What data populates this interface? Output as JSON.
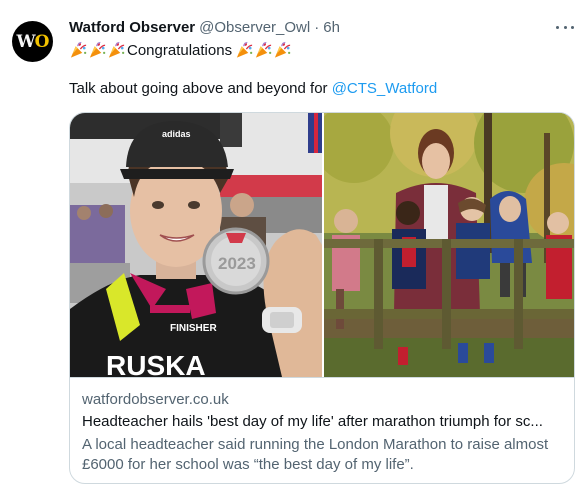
{
  "author": {
    "display_name": "Watford Observer",
    "handle": "@Observer_Owl",
    "separator": "·",
    "time": "6h",
    "avatar_text_w": "W",
    "avatar_text_o": "O"
  },
  "tweet": {
    "congrats_text": "Congratulations",
    "emoji_icon": "party-popper",
    "body_prefix": "Talk about going above and beyond for ",
    "mention": "@CTS_Watford"
  },
  "card": {
    "domain": "watfordobserver.co.uk",
    "title": "Headteacher hails 'best day of my life' after marathon triumph for sc...",
    "description": "A local headteacher said running the London Marathon to raise almost £6000 for her school was “the best day of my life”.",
    "shirt_text": "RUSKA",
    "medal_text": "2023"
  },
  "colors": {
    "link": "#1d9bf0",
    "secondary_text": "#536471",
    "border": "#cfd9de"
  }
}
